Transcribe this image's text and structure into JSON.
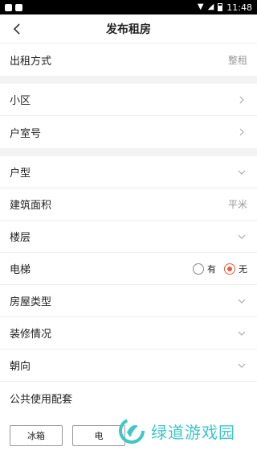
{
  "status_bar": {
    "time": "11:48"
  },
  "header": {
    "title": "发布租房"
  },
  "rental_method": {
    "label": "出租方式",
    "value": "整租"
  },
  "community": {
    "label": "小区"
  },
  "room_number": {
    "label": "户室号"
  },
  "layout": {
    "label": "户型"
  },
  "area": {
    "label": "建筑面积",
    "placeholder": "平米"
  },
  "floor": {
    "label": "楼层"
  },
  "elevator": {
    "label": "电梯",
    "options": [
      "有",
      "无"
    ],
    "selected": "无"
  },
  "house_type": {
    "label": "房屋类型"
  },
  "decoration": {
    "label": "装修情况"
  },
  "orientation": {
    "label": "朝向"
  },
  "facilities": {
    "label": "公共使用配套",
    "chips": [
      "冰箱",
      "电"
    ]
  },
  "watermark": {
    "text": "绿道游戏园"
  },
  "colors": {
    "accent": "#e85a3c",
    "watermark": "#3ec7c4"
  }
}
